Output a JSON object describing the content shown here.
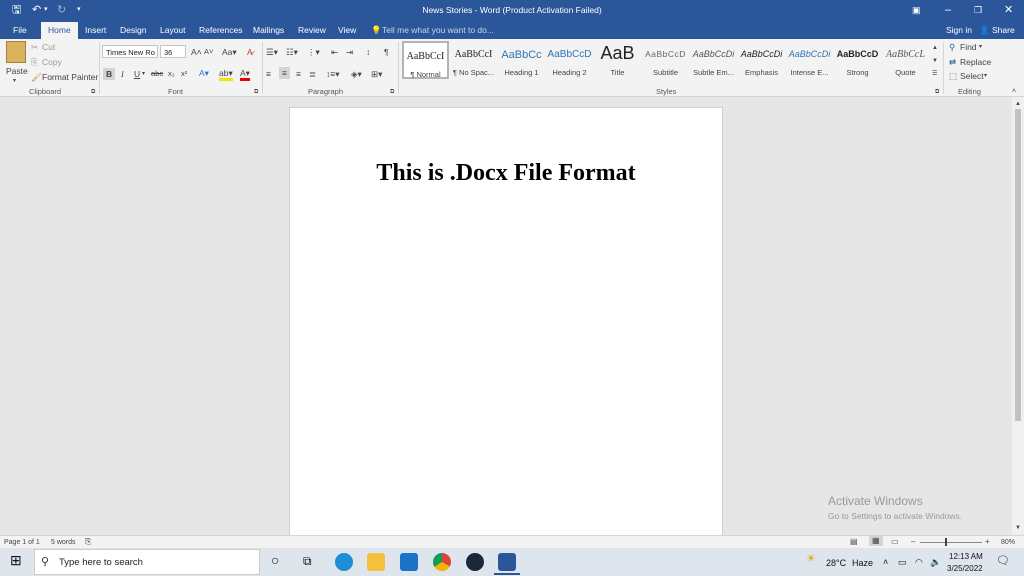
{
  "titlebar": {
    "title": "News Stories - Word (Product Activation Failed)"
  },
  "tabs": {
    "file": "File",
    "home": "Home",
    "insert": "Insert",
    "design": "Design",
    "layout": "Layout",
    "references": "References",
    "mailings": "Mailings",
    "review": "Review",
    "view": "View",
    "tell_me": "Tell me what you want to do...",
    "sign_in": "Sign in",
    "share": "Share"
  },
  "clipboard": {
    "paste": "Paste",
    "cut": "Cut",
    "copy": "Copy",
    "format_painter": "Format Painter",
    "label": "Clipboard"
  },
  "font": {
    "name": "Times New Ro",
    "size": "36",
    "label": "Font"
  },
  "paragraph": {
    "label": "Paragraph"
  },
  "styles": {
    "label": "Styles",
    "items": [
      {
        "preview": "AaBbCcI",
        "name": "¶ Normal"
      },
      {
        "preview": "AaBbCcI",
        "name": "¶ No Spac..."
      },
      {
        "preview": "AaBbCc",
        "name": "Heading 1"
      },
      {
        "preview": "AaBbCcD",
        "name": "Heading 2"
      },
      {
        "preview": "AaB",
        "name": "Title"
      },
      {
        "preview": "AaBbCcD",
        "name": "Subtitle"
      },
      {
        "preview": "AaBbCcDi",
        "name": "Subtle Em..."
      },
      {
        "preview": "AaBbCcDi",
        "name": "Emphasis"
      },
      {
        "preview": "AaBbCcDi",
        "name": "Intense E..."
      },
      {
        "preview": "AaBbCcD",
        "name": "Strong"
      },
      {
        "preview": "AaBbCcL",
        "name": "Quote"
      }
    ]
  },
  "editing": {
    "find": "Find",
    "replace": "Replace",
    "select": "Select",
    "label": "Editing"
  },
  "document": {
    "heading": "This is .Docx File Format"
  },
  "status": {
    "page": "Page 1 of 1",
    "words": "5 words",
    "zoom": "80%"
  },
  "watermark": {
    "line1": "Activate Windows",
    "line2": "Go to Settings to activate Windows."
  },
  "taskbar": {
    "search_placeholder": "Type here to search",
    "weather": "28°C",
    "weather_desc": "Haze",
    "time": "12:13 AM",
    "date": "3/25/2022"
  },
  "colors": {
    "accent": "#2b579a",
    "ribbon_bg": "#f3f3f3",
    "doc_bg": "#e6e6e6"
  }
}
